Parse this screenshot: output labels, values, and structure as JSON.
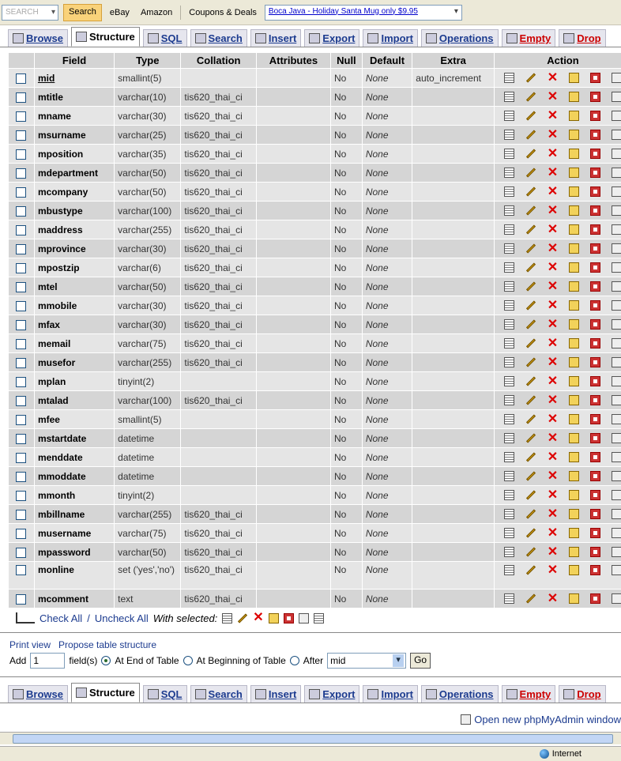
{
  "toolbar": {
    "search_placeholder": "SEARCH",
    "search_btn": "Search",
    "ebay": "eBay",
    "amazon": "Amazon",
    "coupons": "Coupons & Deals",
    "ad_text": "Boca Java - Holiday Santa Mug only $9.95"
  },
  "tabs": [
    {
      "label": "Browse",
      "icon": "browse-icon"
    },
    {
      "label": "Structure",
      "icon": "structure-icon"
    },
    {
      "label": "SQL",
      "icon": "sql-icon"
    },
    {
      "label": "Search",
      "icon": "search-icon"
    },
    {
      "label": "Insert",
      "icon": "insert-icon"
    },
    {
      "label": "Export",
      "icon": "export-icon"
    },
    {
      "label": "Import",
      "icon": "import-icon"
    },
    {
      "label": "Operations",
      "icon": "operations-icon"
    },
    {
      "label": "Empty",
      "icon": "empty-icon"
    },
    {
      "label": "Drop",
      "icon": "drop-icon"
    }
  ],
  "columns": [
    "Field",
    "Type",
    "Collation",
    "Attributes",
    "Null",
    "Default",
    "Extra",
    "Action"
  ],
  "rows": [
    {
      "field": "mid",
      "type": "smallint(5)",
      "collation": "",
      "null": "No",
      "default": "None",
      "extra": "auto_increment"
    },
    {
      "field": "mtitle",
      "type": "varchar(10)",
      "collation": "tis620_thai_ci",
      "null": "No",
      "default": "None",
      "extra": ""
    },
    {
      "field": "mname",
      "type": "varchar(30)",
      "collation": "tis620_thai_ci",
      "null": "No",
      "default": "None",
      "extra": ""
    },
    {
      "field": "msurname",
      "type": "varchar(25)",
      "collation": "tis620_thai_ci",
      "null": "No",
      "default": "None",
      "extra": ""
    },
    {
      "field": "mposition",
      "type": "varchar(35)",
      "collation": "tis620_thai_ci",
      "null": "No",
      "default": "None",
      "extra": ""
    },
    {
      "field": "mdepartment",
      "type": "varchar(50)",
      "collation": "tis620_thai_ci",
      "null": "No",
      "default": "None",
      "extra": ""
    },
    {
      "field": "mcompany",
      "type": "varchar(50)",
      "collation": "tis620_thai_ci",
      "null": "No",
      "default": "None",
      "extra": ""
    },
    {
      "field": "mbustype",
      "type": "varchar(100)",
      "collation": "tis620_thai_ci",
      "null": "No",
      "default": "None",
      "extra": ""
    },
    {
      "field": "maddress",
      "type": "varchar(255)",
      "collation": "tis620_thai_ci",
      "null": "No",
      "default": "None",
      "extra": ""
    },
    {
      "field": "mprovince",
      "type": "varchar(30)",
      "collation": "tis620_thai_ci",
      "null": "No",
      "default": "None",
      "extra": ""
    },
    {
      "field": "mpostzip",
      "type": "varchar(6)",
      "collation": "tis620_thai_ci",
      "null": "No",
      "default": "None",
      "extra": ""
    },
    {
      "field": "mtel",
      "type": "varchar(50)",
      "collation": "tis620_thai_ci",
      "null": "No",
      "default": "None",
      "extra": ""
    },
    {
      "field": "mmobile",
      "type": "varchar(30)",
      "collation": "tis620_thai_ci",
      "null": "No",
      "default": "None",
      "extra": ""
    },
    {
      "field": "mfax",
      "type": "varchar(30)",
      "collation": "tis620_thai_ci",
      "null": "No",
      "default": "None",
      "extra": ""
    },
    {
      "field": "memail",
      "type": "varchar(75)",
      "collation": "tis620_thai_ci",
      "null": "No",
      "default": "None",
      "extra": ""
    },
    {
      "field": "musefor",
      "type": "varchar(255)",
      "collation": "tis620_thai_ci",
      "null": "No",
      "default": "None",
      "extra": ""
    },
    {
      "field": "mplan",
      "type": "tinyint(2)",
      "collation": "",
      "null": "No",
      "default": "None",
      "extra": ""
    },
    {
      "field": "mtalad",
      "type": "varchar(100)",
      "collation": "tis620_thai_ci",
      "null": "No",
      "default": "None",
      "extra": ""
    },
    {
      "field": "mfee",
      "type": "smallint(5)",
      "collation": "",
      "null": "No",
      "default": "None",
      "extra": ""
    },
    {
      "field": "mstartdate",
      "type": "datetime",
      "collation": "",
      "null": "No",
      "default": "None",
      "extra": ""
    },
    {
      "field": "menddate",
      "type": "datetime",
      "collation": "",
      "null": "No",
      "default": "None",
      "extra": ""
    },
    {
      "field": "mmoddate",
      "type": "datetime",
      "collation": "",
      "null": "No",
      "default": "None",
      "extra": ""
    },
    {
      "field": "mmonth",
      "type": "tinyint(2)",
      "collation": "",
      "null": "No",
      "default": "None",
      "extra": ""
    },
    {
      "field": "mbillname",
      "type": "varchar(255)",
      "collation": "tis620_thai_ci",
      "null": "No",
      "default": "None",
      "extra": ""
    },
    {
      "field": "musername",
      "type": "varchar(75)",
      "collation": "tis620_thai_ci",
      "null": "No",
      "default": "None",
      "extra": ""
    },
    {
      "field": "mpassword",
      "type": "varchar(50)",
      "collation": "tis620_thai_ci",
      "null": "No",
      "default": "None",
      "extra": ""
    },
    {
      "field": "monline",
      "type": "set ('yes','no')",
      "collation": "tis620_thai_ci",
      "null": "No",
      "default": "None",
      "extra": ""
    },
    {
      "field": "mcomment",
      "type": "text",
      "collation": "tis620_thai_ci",
      "null": "No",
      "default": "None",
      "extra": ""
    }
  ],
  "footer": {
    "check_all": "Check All",
    "sep": "/",
    "uncheck_all": "Uncheck All",
    "with_selected": "With selected:"
  },
  "print_view": "Print view",
  "propose": "Propose table structure",
  "add": {
    "label": "Add",
    "value": "1",
    "fields": "field(s)",
    "at_end": "At End of Table",
    "at_begin": "At Beginning of Table",
    "after": "After",
    "after_value": "mid",
    "go": "Go"
  },
  "open_new": "Open new phpMyAdmin window",
  "status": {
    "zone": "Internet"
  }
}
